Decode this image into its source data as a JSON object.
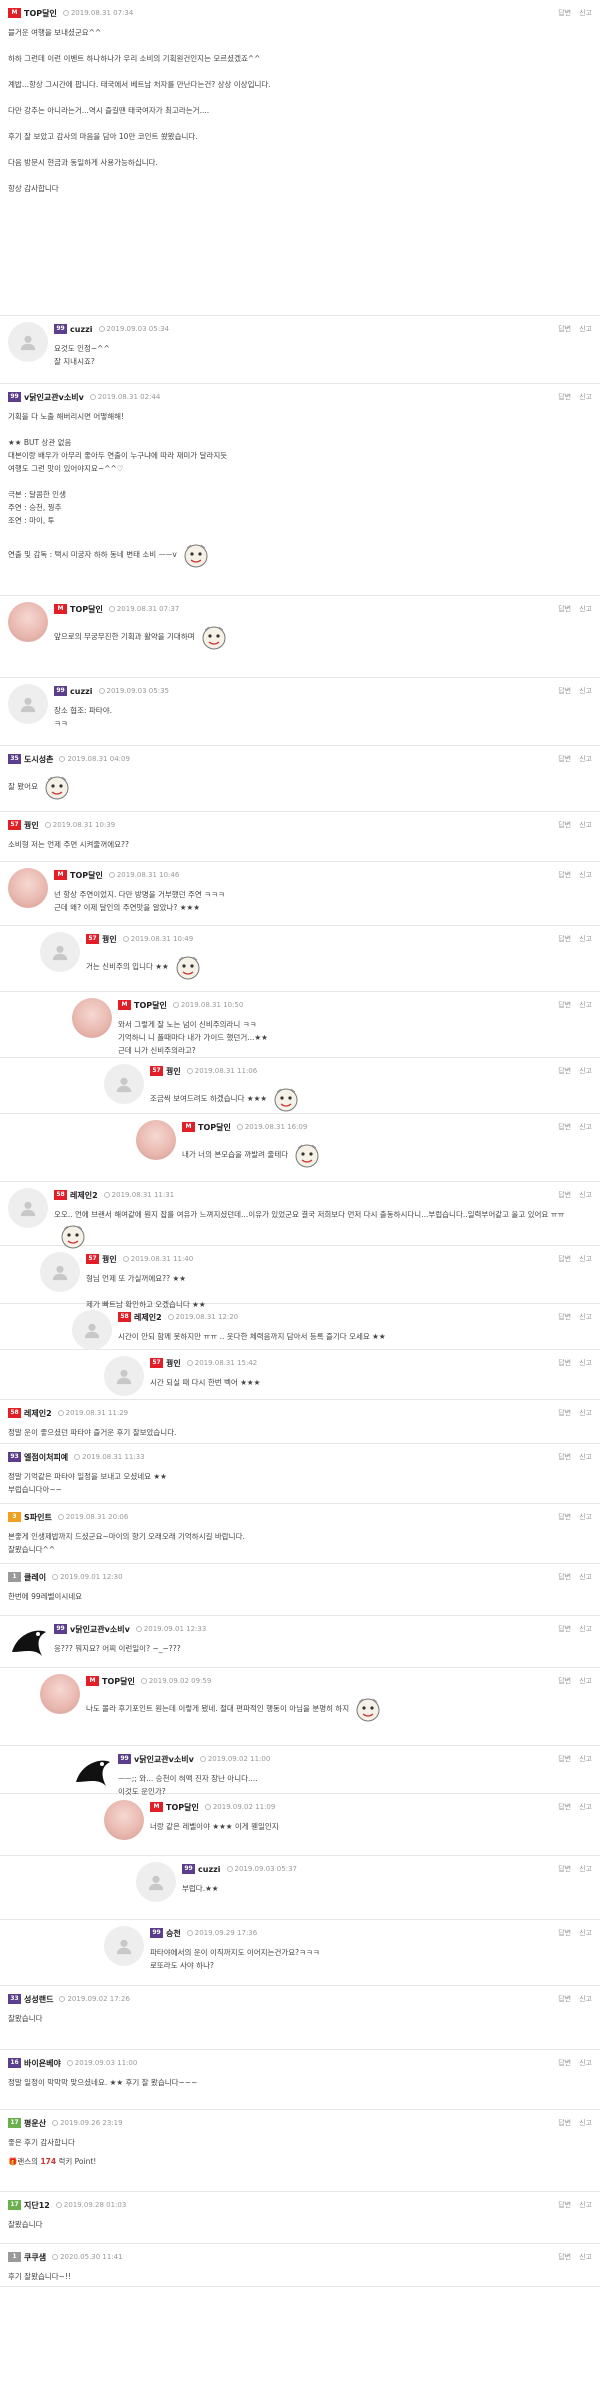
{
  "actions": {
    "reply": "답변",
    "report": "신고"
  },
  "colors": {
    "red": "#e21f26",
    "purple": "#5b3e8c",
    "green": "#6ab04c",
    "gray": "#9a9a9a",
    "orange": "#f0a020"
  },
  "comments": [
    {
      "indent": 0,
      "avatar": null,
      "badge": "M",
      "badgeColor": "red",
      "nick": "TOP달인",
      "date": "2019.08.31 07:34",
      "body": "블거운 여행을 보내셨군요^^\n\n하하 그런데 이런 이벤트 하나하나가 우리 소비의 기획원건인지는 모르셨겠죠^^\n\n계밥...항상 그시간에 팝니다. 태국에서 베트남 처자를 만난다는건? 상상 이상입니다.\n\n다만 강추는 아니라는거...역시 즐길땐 태국여자가 최고라는거....\n\n후기 잘 보았고 감사의 마음을 담아 10만 코인트 쐈봤습니다.\n\n다음 방문시 현금과 동일하게 사용가능하십니다.\n\n항상 감사합니다",
      "h": 316
    },
    {
      "indent": 0,
      "avatar": "default",
      "badge": "99",
      "badgeColor": "purple",
      "nick": "cuzzi",
      "date": "2019.09.03 05:34",
      "body": "요것도 인정~^^\n잘 지내시죠?",
      "h": 68
    },
    {
      "indent": 0,
      "avatar": null,
      "badge": "99",
      "badgeColor": "purple",
      "nick": "v닭인교관v소비v",
      "date": "2019.08.31 02:44",
      "body": "기획을 다 노출 해버리시면 어떻해해!\n\n★★ BUT 상관 없음\n대본이랑 배우가 아무리 좋아두 연출이 누구냐에 따라 재미가 달라지듯\n여행도 그런 맛이 있어야지요~^^♡\n\n극본 : 달콤한 인생\n주연 : 승천, 꿩추\n조연 : 마이, 투\n\n연출 및 감독 : 택시 미궁자 하하 동네 변태 소비 ㅡㅡv",
      "h": 212,
      "emoji": true
    },
    {
      "indent": 0,
      "avatar": "pink",
      "badge": "M",
      "badgeColor": "red",
      "nick": "TOP달인",
      "date": "2019.08.31 07:37",
      "body": "앞으로의 무궁무진한 기획과 활약을 기대하며",
      "h": 82,
      "emoji": true
    },
    {
      "indent": 0,
      "avatar": "default",
      "badge": "99",
      "badgeColor": "purple",
      "nick": "cuzzi",
      "date": "2019.09.03 05:35",
      "body": "장소 협조: 파타야.\nㅋㅋ",
      "h": 68
    },
    {
      "indent": 0,
      "avatar": null,
      "badge": "35",
      "badgeColor": "purple",
      "nick": "도시성촌",
      "date": "2019.08.31 04:09",
      "body": "잘 봤어요",
      "h": 66,
      "emoji": true
    },
    {
      "indent": 0,
      "avatar": null,
      "badge": "57",
      "badgeColor": "red",
      "nick": "꿩인",
      "date": "2019.08.31 10:39",
      "body": "소비형 저는 언제 주면 시켜줄꺼에요??",
      "h": 50
    },
    {
      "indent": 0,
      "avatar": "pink",
      "badge": "M",
      "badgeColor": "red",
      "nick": "TOP달인",
      "date": "2019.08.31 10:46",
      "body": "넌 항상 주연이었지. 다만 방명을 거부했던 주연 ㅋㅋㅋ\n근데 왜? 이제 달인의 주연맛을 알았나? ★★★",
      "h": 64
    },
    {
      "indent": 1,
      "avatar": "default",
      "badge": "57",
      "badgeColor": "red",
      "nick": "꿩인",
      "date": "2019.08.31 10:49",
      "body": "거는 신비주의 입니다 ★★",
      "h": 66,
      "emoji": true
    },
    {
      "indent": 2,
      "avatar": "pink",
      "badge": "M",
      "badgeColor": "red",
      "nick": "TOP달인",
      "date": "2019.08.31 10:50",
      "body": "와서 그렇게 잘 노는 넘이 신비주의라니 ㅋㅋ\n기억하니 니 폴때마다 내가 가이드 했던거...★★\n근데 니가 신비주의라고?",
      "h": 66
    },
    {
      "indent": 3,
      "avatar": "default",
      "badge": "57",
      "badgeColor": "red",
      "nick": "꿩인",
      "date": "2019.08.31 11:06",
      "body": "조금씩 보여드려도 하겠습니다 ★★★",
      "h": 56,
      "emoji": true
    },
    {
      "indent": 4,
      "avatar": "pink",
      "badge": "M",
      "badgeColor": "red",
      "nick": "TOP달인",
      "date": "2019.08.31 16:09",
      "body": "내가 너의 본모습을 까발려 줄테다",
      "h": 68,
      "emoji": true
    },
    {
      "indent": 0,
      "avatar": "default",
      "badge": "58",
      "badgeColor": "red",
      "nick": "레제인2",
      "date": "2019.08.31 11:31",
      "body": "오오.. 언에 브랜서 해여같에 뭔지 잡를 여유가 느껴지셨던데...이유가 있었군요 결국 저희보다 먼저 다시 출동하시다니...부럽습니다..일력부어같고 올고 있어요 ㅠㅠ",
      "h": 64,
      "emoji": true
    },
    {
      "indent": 1,
      "avatar": "default",
      "badge": "57",
      "badgeColor": "red",
      "nick": "꿩인",
      "date": "2019.08.31 11:40",
      "body": "형님 언제 또 가실꺼에요?? ★★\n\n제가 빠트남 확인하고 오겠습니다 ★★",
      "h": 58
    },
    {
      "indent": 2,
      "avatar": "default",
      "badge": "58",
      "badgeColor": "red",
      "nick": "레제인2",
      "date": "2019.08.31 12:20",
      "body": "시간이 안되 함께 못하지만 ㅠㅠ .. 웃다한 체력음까지 담아서 등록 즐기다 오세요 ★★",
      "h": 46
    },
    {
      "indent": 3,
      "avatar": "default",
      "badge": "57",
      "badgeColor": "red",
      "nick": "꿩인",
      "date": "2019.08.31 15:42",
      "body": "시간 되실 때 다시 한번 벡어 ★★★",
      "h": 50
    },
    {
      "indent": 0,
      "avatar": null,
      "badge": "58",
      "badgeColor": "red",
      "nick": "레제인2",
      "date": "2019.08.31 11:29",
      "body": "정말 운이 좋으셨던 파타야 즐거운 후기 잘보았습니다.",
      "h": 44
    },
    {
      "indent": 0,
      "avatar": null,
      "badge": "93",
      "badgeColor": "purple",
      "nick": "엘점이처피예",
      "date": "2019.08.31 11:33",
      "body": "정말 기억같은 파타야 일정을 보내고 오셨네요 ★★\n부럽습니다아~~",
      "h": 60
    },
    {
      "indent": 0,
      "avatar": null,
      "badge": "3",
      "badgeColor": "orange",
      "nick": "S파인트",
      "date": "2019.08.31 20:06",
      "body": "본좋게 인생제밥까지 드셨군요~마이의 향기 오래오래 기억하시길 바랍니다.\n잘봤습니다^^",
      "h": 60
    },
    {
      "indent": 0,
      "avatar": null,
      "badge": "1",
      "badgeColor": "gray",
      "nick": "클레이",
      "date": "2019.09.01 12:30",
      "body": "한번에 99레벨이시네요",
      "h": 52
    },
    {
      "indent": 0,
      "avatar": "black",
      "badge": "99",
      "badgeColor": "purple",
      "nick": "v닭인교관v소비v",
      "date": "2019.09.01 12:33",
      "body": "응??? 뭐지요? 어찌 이런일이? ~_~???",
      "h": 52
    },
    {
      "indent": 1,
      "avatar": "pink",
      "badge": "M",
      "badgeColor": "red",
      "nick": "TOP달인",
      "date": "2019.09.02 09:59",
      "body": "나도 몰라 후기포인트 원는데 이렇게 됐네. 절대 편파적인 행동이 아님을 분명히 하지",
      "h": 78,
      "emoji": true
    },
    {
      "indent": 2,
      "avatar": "black",
      "badge": "99",
      "badgeColor": "purple",
      "nick": "v닭인교관v소비v",
      "date": "2019.09.02 11:00",
      "body": "ㅡㅡ;; 와... 승천이 혀맥 진자 장난 아니다....\n이것도 운인가?",
      "h": 48
    },
    {
      "indent": 3,
      "avatar": "pink",
      "badge": "M",
      "badgeColor": "red",
      "nick": "TOP달인",
      "date": "2019.09.02 11:09",
      "body": "너랑 같은 레벨이야 ★★★ 이게 웬일인지",
      "h": 62
    },
    {
      "indent": 4,
      "avatar": "default",
      "badge": "99",
      "badgeColor": "purple",
      "nick": "cuzzi",
      "date": "2019.09.03 05:37",
      "body": "부럽다.★★",
      "h": 64
    },
    {
      "indent": 3,
      "avatar": "default",
      "badge": "99",
      "badgeColor": "purple",
      "nick": "승천",
      "date": "2019.09.29 17:36",
      "body": "파타야에서의 운이 이직까지도 이어지는건가요?ㅋㅋㅋ\n로또라도 사야 하나?",
      "h": 66
    },
    {
      "indent": 0,
      "avatar": null,
      "badge": "33",
      "badgeColor": "purple",
      "nick": "성성랜드",
      "date": "2019.09.02 17:26",
      "body": "잘봤습니다",
      "h": 64
    },
    {
      "indent": 0,
      "avatar": null,
      "badge": "16",
      "badgeColor": "purple",
      "nick": "바이욘베야",
      "date": "2019.09.03 11:00",
      "body": "정말 일정이 막막막 맞으셨네요. ★★ 후기 잘 봤습니다~~~",
      "h": 60
    },
    {
      "indent": 0,
      "avatar": null,
      "badge": "17",
      "badgeColor": "green",
      "nick": "평운산",
      "date": "2019.09.26 23:19",
      "body": "좋은 후기 감사합니다",
      "h": 82,
      "point": {
        "prefix": "랜스의 ",
        "amount": "174",
        "suffix": " 럭키 Point!"
      }
    },
    {
      "indent": 0,
      "avatar": null,
      "badge": "17",
      "badgeColor": "green",
      "nick": "지단12",
      "date": "2019.09.28 01:03",
      "body": "잘봤습니다",
      "h": 52
    },
    {
      "indent": 0,
      "avatar": null,
      "badge": "1",
      "badgeColor": "gray",
      "nick": "쿠쿠샘",
      "date": "2020.05.30 11:41",
      "body": "후기 잘봤습니다~!!",
      "h": 43
    }
  ]
}
